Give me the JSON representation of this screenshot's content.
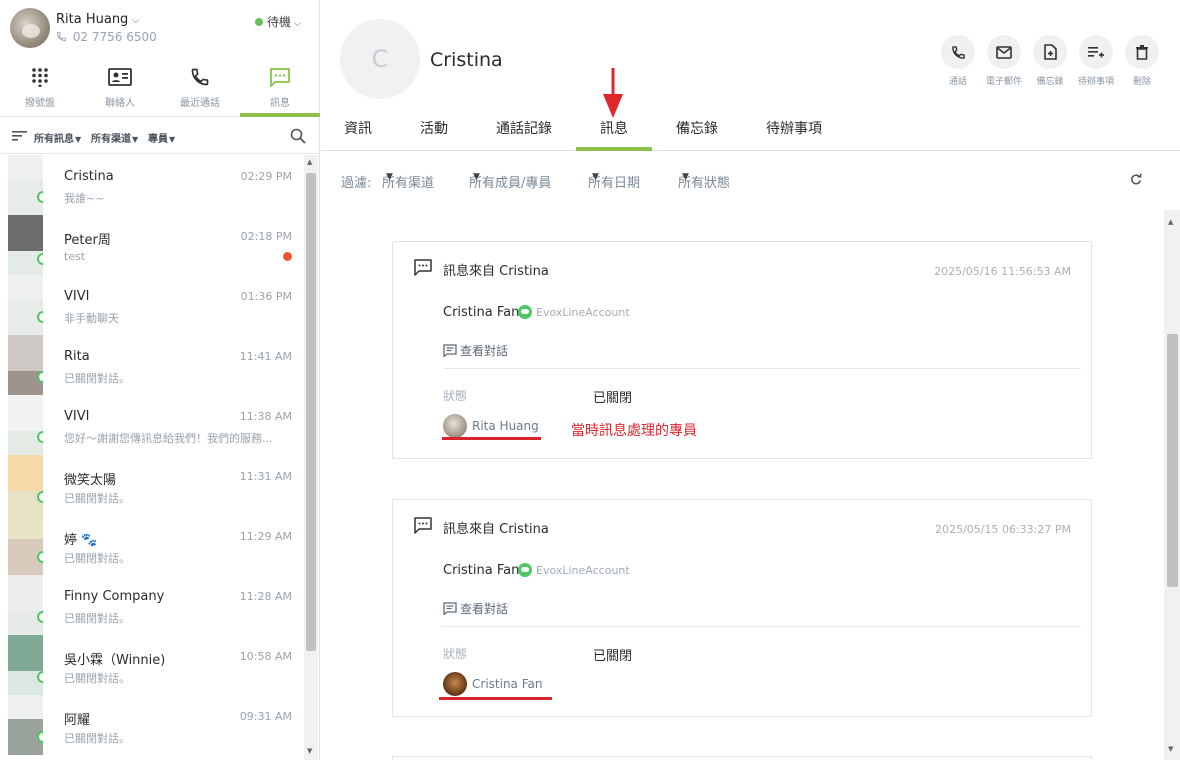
{
  "user": {
    "name": "Rita Huang",
    "phone": "02 7756 6500",
    "status": "待機"
  },
  "nav": {
    "tabs": [
      {
        "label": "撥號盤",
        "icon": "dialpad-icon"
      },
      {
        "label": "聯絡人",
        "icon": "contact-card-icon"
      },
      {
        "label": "最近通話",
        "icon": "phone-icon"
      },
      {
        "label": "訊息",
        "icon": "chat-icon",
        "active": true
      }
    ]
  },
  "list_filters": {
    "messages": "所有訊息",
    "channels": "所有渠道",
    "agent": "專員"
  },
  "conversations": [
    {
      "name": "Cristina",
      "preview": "我誰~~",
      "time": "02:29 PM",
      "unread": false
    },
    {
      "name": "Peter周",
      "preview": "test",
      "time": "02:18 PM",
      "unread": true
    },
    {
      "name": "VIVI",
      "preview": "非手動聊天",
      "time": "01:36 PM",
      "unread": false
    },
    {
      "name": "Rita",
      "preview": "已關閉對話。",
      "time": "11:41 AM",
      "unread": false
    },
    {
      "name": "VIVI",
      "preview": "您好～謝謝您傳訊息給我們！我們的服務...",
      "time": "11:38 AM",
      "unread": false
    },
    {
      "name": "微笑太陽",
      "preview": "已關閉對話。",
      "time": "11:31 AM",
      "unread": false
    },
    {
      "name": "婷 🐾",
      "preview": "已關閉對話。",
      "time": "11:29 AM",
      "unread": false
    },
    {
      "name": "Finny Company",
      "preview": "已關閉對話。",
      "time": "11:28 AM",
      "unread": false
    },
    {
      "name": "吳小霖（Winnie)",
      "preview": "已關閉對話。",
      "time": "10:58 AM",
      "unread": false
    },
    {
      "name": "阿耀",
      "preview": "已關閉對話。",
      "time": "09:31 AM",
      "unread": false
    }
  ],
  "contact": {
    "initial": "C",
    "name": "Cristina"
  },
  "actions": [
    {
      "label": "通話",
      "icon": "phone-icon"
    },
    {
      "label": "電子郵件",
      "icon": "mail-icon"
    },
    {
      "label": "備忘錄",
      "icon": "note-add-icon"
    },
    {
      "label": "待辦事項",
      "icon": "todo-add-icon"
    },
    {
      "label": "刪除",
      "icon": "trash-icon"
    }
  ],
  "main_tabs": [
    {
      "label": "資訊"
    },
    {
      "label": "活動"
    },
    {
      "label": "通話記錄"
    },
    {
      "label": "訊息",
      "active": true
    },
    {
      "label": "備忘錄"
    },
    {
      "label": "待辦事項"
    }
  ],
  "filters": {
    "label": "過濾:",
    "channels": "所有渠道",
    "members": "所有成員/專員",
    "dates": "所有日期",
    "statuses": "所有狀態"
  },
  "messages": [
    {
      "title": "訊息來自 Cristina",
      "datetime": "2025/05/16 11:56:53 AM",
      "sender": "Cristina Fan",
      "account": "EvoxLineAccount",
      "view_label": "查看對話",
      "status_label": "狀態",
      "status_value": "已關閉",
      "agent": "Rita Huang",
      "note": "當時訊息處理的專員"
    },
    {
      "title": "訊息來自 Cristina",
      "datetime": "2025/05/15 06:33:27 PM",
      "sender": "Cristina Fan",
      "account": "EvoxLineAccount",
      "view_label": "查看對話",
      "status_label": "狀態",
      "status_value": "已關閉",
      "agent": "Cristina Fan"
    }
  ],
  "colors": {
    "accent": "#8bc34a",
    "online": "#6bbf59",
    "line_green": "#4cc764",
    "annotation_red": "#d9242c",
    "unread": "#f2552c"
  }
}
